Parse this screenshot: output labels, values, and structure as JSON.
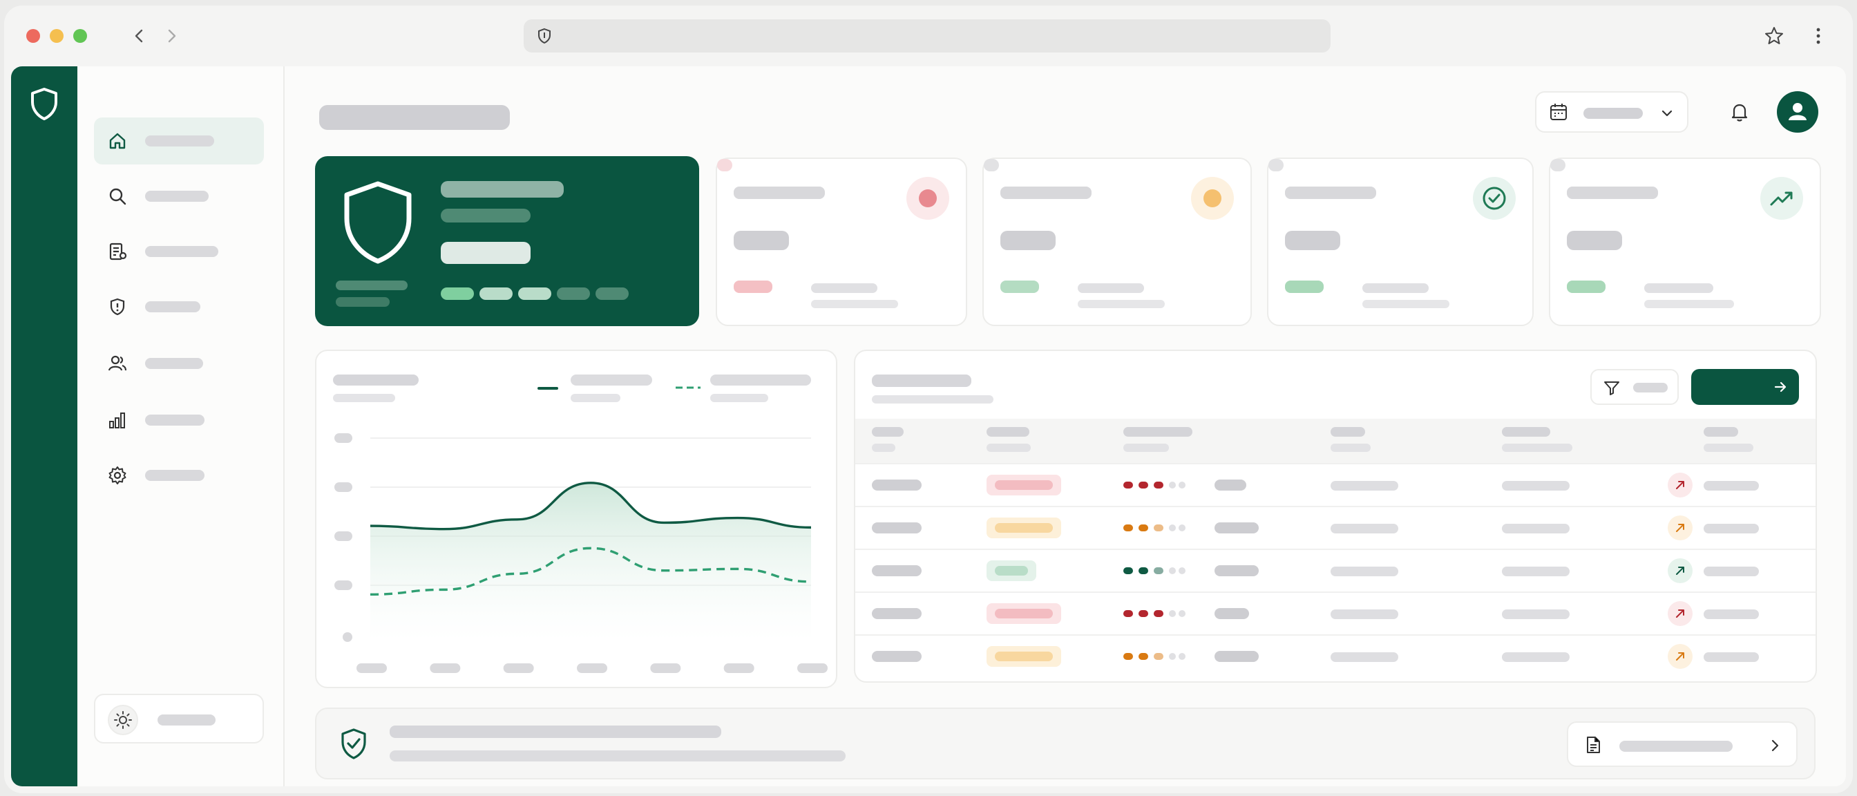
{
  "window": {
    "controls": [
      "close",
      "minimize",
      "maximize"
    ]
  },
  "browser": {
    "back_icon": "chevron-left-icon",
    "forward_icon": "chevron-right-icon",
    "url_icon": "shield-icon",
    "bookmark_icon": "star-icon",
    "menu_icon": "kebab-menu-icon"
  },
  "rail": {
    "logo_icon": "shield-icon"
  },
  "sidebar": {
    "items": [
      {
        "icon": "home-icon",
        "active": true
      },
      {
        "icon": "search-icon"
      },
      {
        "icon": "document-list-icon"
      },
      {
        "icon": "shield-alert-icon"
      },
      {
        "icon": "users-icon"
      },
      {
        "icon": "bar-chart-icon"
      },
      {
        "icon": "gear-icon"
      }
    ],
    "theme_toggle_icon": "sun-icon"
  },
  "header": {
    "date_icon": "calendar-icon",
    "dropdown_icon": "chevron-down-icon",
    "notification_icon": "bell-icon",
    "avatar_icon": "user-icon"
  },
  "hero": {
    "icon": "shield-icon",
    "progress_segments": 5,
    "segments_filled": 3
  },
  "stat_cards": [
    {
      "icon": "red-dot-icon",
      "accent": "#e8898f",
      "tint": "#fbe9ea"
    },
    {
      "icon": "amber-dot-icon",
      "accent": "#f5c06f",
      "tint": "#fdf1df"
    },
    {
      "icon": "check-circle-icon",
      "accent": "#1f7a55",
      "tint": "#e7f3ee"
    },
    {
      "icon": "trending-up-icon",
      "accent": "#1f7a55",
      "tint": "#e9f4ef"
    }
  ],
  "chart_data": {
    "type": "area",
    "categories": [
      "",
      "",
      "",
      "",
      "",
      "",
      ""
    ],
    "series": [
      {
        "values": [
          68,
          66,
          72,
          95,
          70,
          73,
          67
        ],
        "style": "solid",
        "color": "#0f5a43"
      },
      {
        "values": [
          25,
          28,
          38,
          54,
          40,
          41,
          33
        ],
        "style": "dashed",
        "color": "#2f9f72"
      }
    ],
    "ylim": [
      0,
      130
    ],
    "grid": true
  },
  "table": {
    "filter_icon": "filter-icon",
    "action_icon": "arrow-right-icon",
    "rows": [
      {
        "status": "#fbe3e5",
        "status_inner": "#f3bcc1",
        "severity": "#b3262e",
        "severity_level": 3,
        "trend": "#fbe9ea",
        "trend_color": "#b3262e"
      },
      {
        "status": "#fdf0d9",
        "status_inner": "#f8d79f",
        "severity": "#d97a12",
        "severity_level": 2,
        "trend": "#fdf1df",
        "trend_color": "#d97a12"
      },
      {
        "status": "#e4f2ea",
        "status_inner": "#b9ddc8",
        "severity": "#0f5a43",
        "severity_level": 2,
        "trend": "#e6f3ec",
        "trend_color": "#0f5a43"
      },
      {
        "status": "#fbe3e5",
        "status_inner": "#f3bcc1",
        "severity": "#b3262e",
        "severity_level": 3,
        "trend": "#fbe9ea",
        "trend_color": "#b3262e"
      },
      {
        "status": "#fdf0d9",
        "status_inner": "#f8d79f",
        "severity": "#d97a12",
        "severity_level": 2,
        "trend": "#fdf1df",
        "trend_color": "#d97a12"
      }
    ]
  },
  "footer": {
    "icon": "shield-check-icon",
    "report_icon": "document-icon",
    "chevron_icon": "chevron-right-icon"
  },
  "colors": {
    "brand": "#0a5540",
    "placeholder": "#d9d9dc",
    "background": "#fbfbfa"
  }
}
